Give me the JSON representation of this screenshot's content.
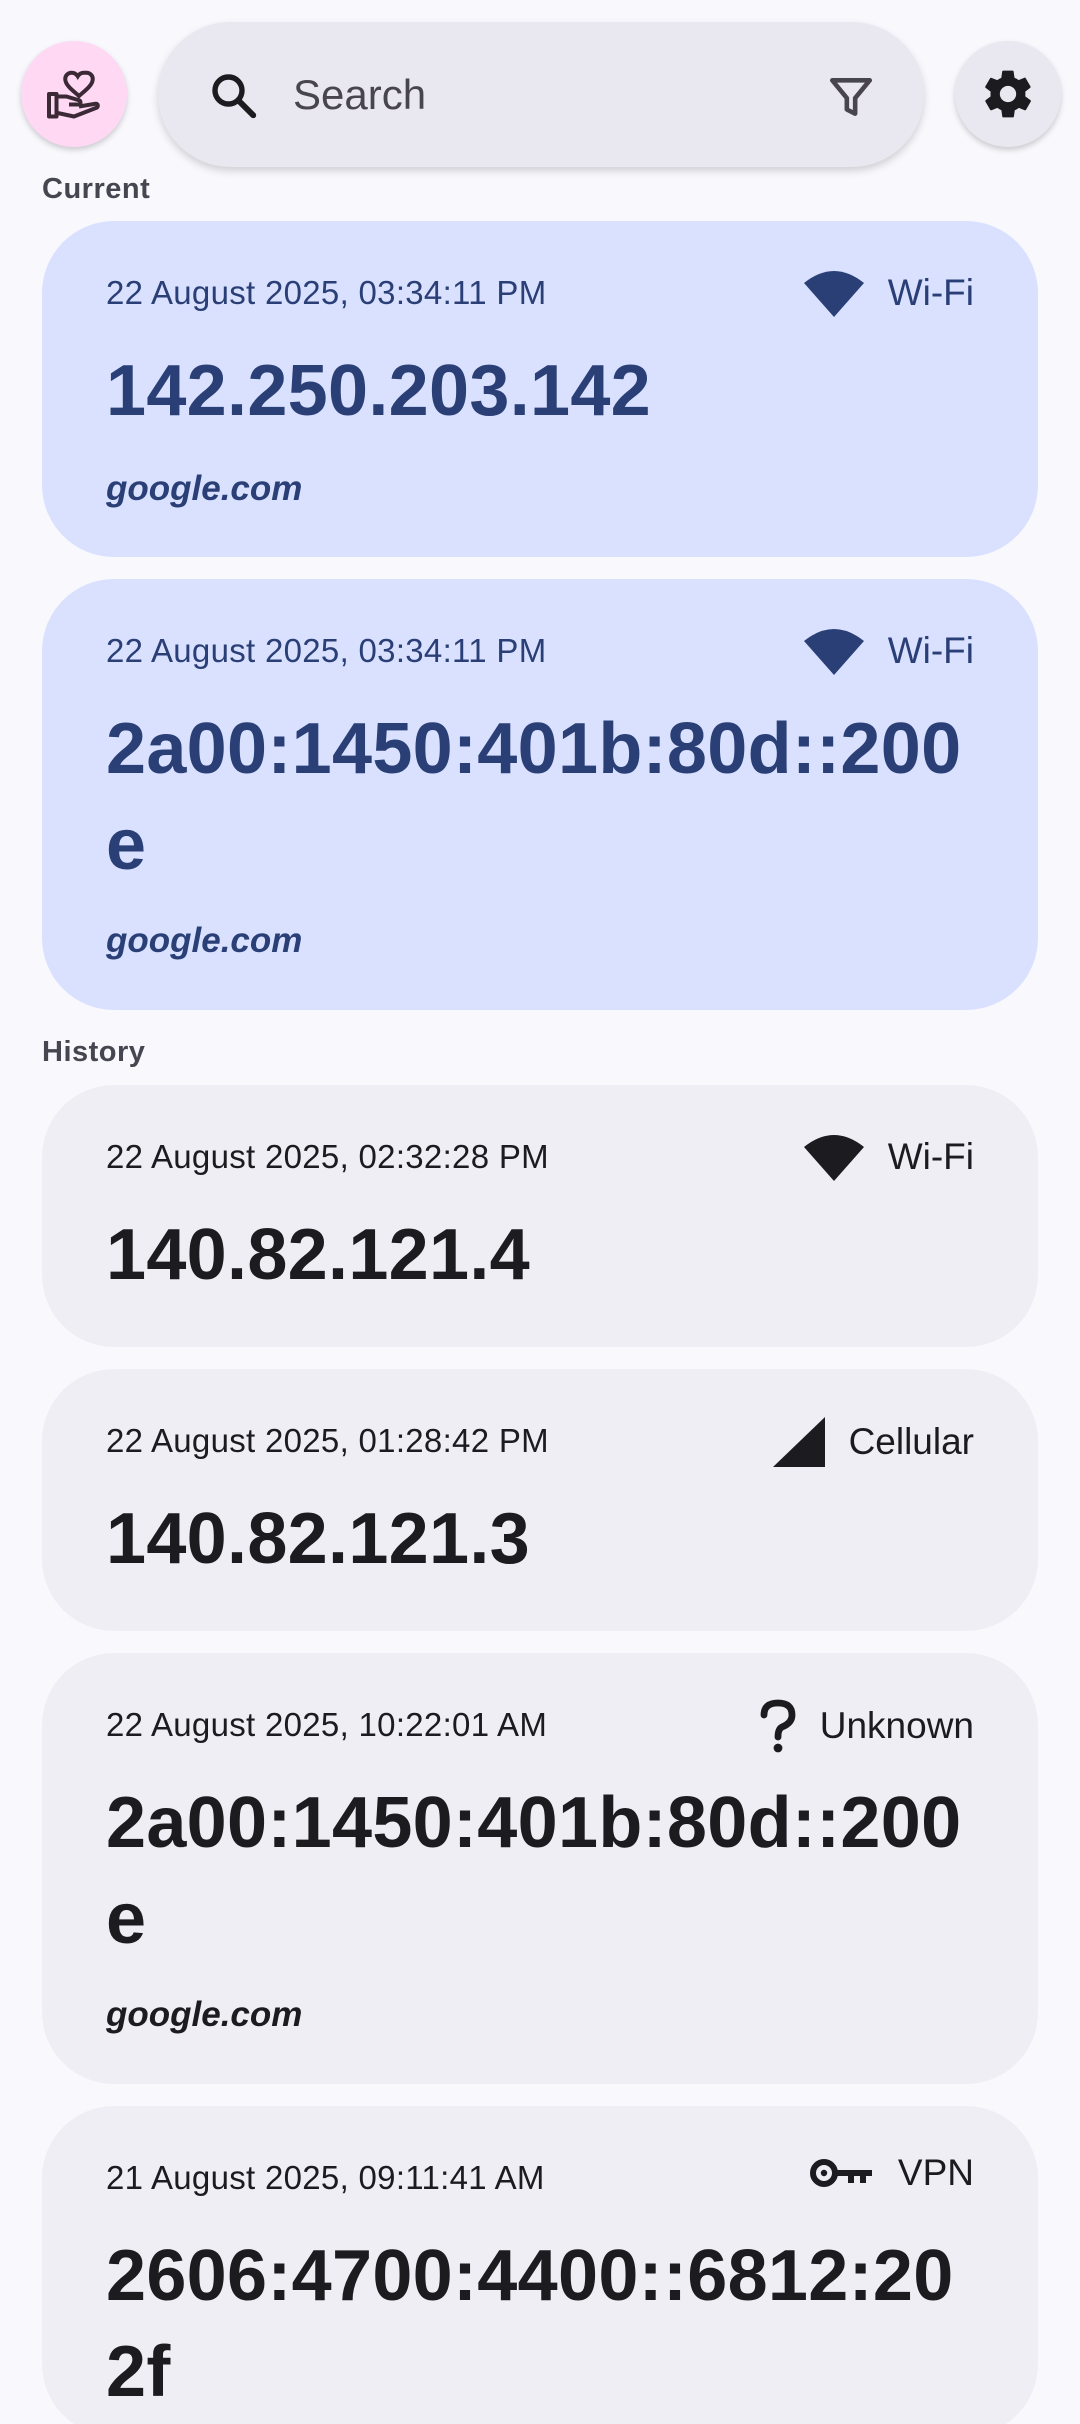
{
  "search": {
    "placeholder": "Search"
  },
  "icons": {
    "donate": "volunteer-activism-icon",
    "search": "search-icon",
    "filter": "filter-icon",
    "settings": "gear-icon"
  },
  "colors": {
    "current_card_bg": "#d9e1ff",
    "current_card_text": "#2b3f77",
    "history_card_bg": "#efeef4",
    "donate_bg": "#ffd8f4"
  },
  "sections": {
    "current_label": "Current",
    "history_label": "History"
  },
  "current": [
    {
      "time": "22 August 2025, 03:34:11 PM",
      "network": "Wi-Fi",
      "network_icon": "wifi-icon",
      "ip": "142.250.203.142",
      "host": "google.com"
    },
    {
      "time": "22 August 2025, 03:34:11 PM",
      "network": "Wi-Fi",
      "network_icon": "wifi-icon",
      "ip": "2a00:1450:401b:80d::200e",
      "host": "google.com"
    }
  ],
  "history": [
    {
      "time": "22 August 2025, 02:32:28 PM",
      "network": "Wi-Fi",
      "network_icon": "wifi-icon",
      "ip": "140.82.121.4",
      "host": ""
    },
    {
      "time": "22 August 2025, 01:28:42 PM",
      "network": "Cellular",
      "network_icon": "cellular-icon",
      "ip": "140.82.121.3",
      "host": ""
    },
    {
      "time": "22 August 2025, 10:22:01 AM",
      "network": "Unknown",
      "network_icon": "question-mark-icon",
      "ip": "2a00:1450:401b:80d::200e",
      "host": "google.com"
    },
    {
      "time": "21 August 2025, 09:11:41 AM",
      "network": "VPN",
      "network_icon": "key-icon",
      "ip": "2606:4700:4400::6812:202f",
      "host": ""
    }
  ]
}
